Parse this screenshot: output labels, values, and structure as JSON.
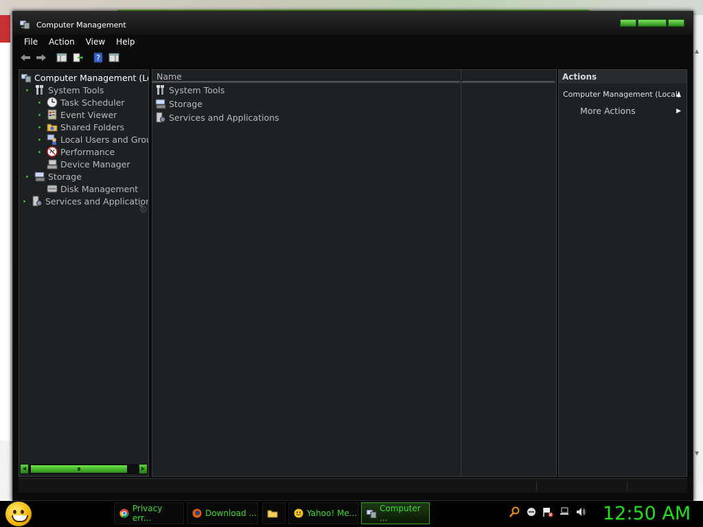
{
  "window": {
    "title": "Computer Management",
    "menu": [
      "File",
      "Action",
      "View",
      "Help"
    ],
    "toolbar_icons": [
      "back-arrow-icon",
      "forward-arrow-icon",
      "show-hide-tree-icon",
      "export-list-icon",
      "help-icon",
      "show-hide-action-pane-icon"
    ]
  },
  "tree": {
    "root": "Computer Management (Loc",
    "items": [
      {
        "label": "System Tools",
        "icon": "tools-icon",
        "bullet": true
      },
      {
        "label": "Task Scheduler",
        "icon": "clock-icon",
        "bullet": true
      },
      {
        "label": "Event Viewer",
        "icon": "event-viewer-icon",
        "bullet": true
      },
      {
        "label": "Shared Folders",
        "icon": "shared-folders-icon",
        "bullet": true
      },
      {
        "label": "Local Users and Grou",
        "icon": "users-icon",
        "bullet": true
      },
      {
        "label": "Performance",
        "icon": "performance-icon",
        "bullet": true
      },
      {
        "label": "Device Manager",
        "icon": "device-manager-icon",
        "bullet": false
      },
      {
        "label": "Storage",
        "icon": "storage-icon",
        "bullet": true
      },
      {
        "label": "Disk Management",
        "icon": "disk-icon",
        "bullet": false
      },
      {
        "label": "Services and Application:",
        "icon": "services-icon",
        "bullet": true
      }
    ]
  },
  "list": {
    "column_name": "Name",
    "rows": [
      "System Tools",
      "Storage",
      "Services and Applications"
    ]
  },
  "actions": {
    "header": "Actions",
    "group": "Computer Management (Local)",
    "items": [
      "More Actions"
    ]
  },
  "taskbar": {
    "buttons": [
      {
        "label": "Privacy err...",
        "icon": "chrome-icon"
      },
      {
        "label": "Download ...",
        "icon": "firefox-icon"
      },
      {
        "label": "",
        "icon": "folder-icon"
      },
      {
        "label": "Yahoo! Me...",
        "icon": "yahoo-messenger-icon"
      },
      {
        "label": "Computer ...",
        "icon": "computer-management-icon"
      }
    ],
    "clock": "12:50 AM"
  },
  "colors": {
    "accent_green": "#2fd820",
    "panel_bg": "#1e2124",
    "window_bg": "#0b0b0b"
  }
}
